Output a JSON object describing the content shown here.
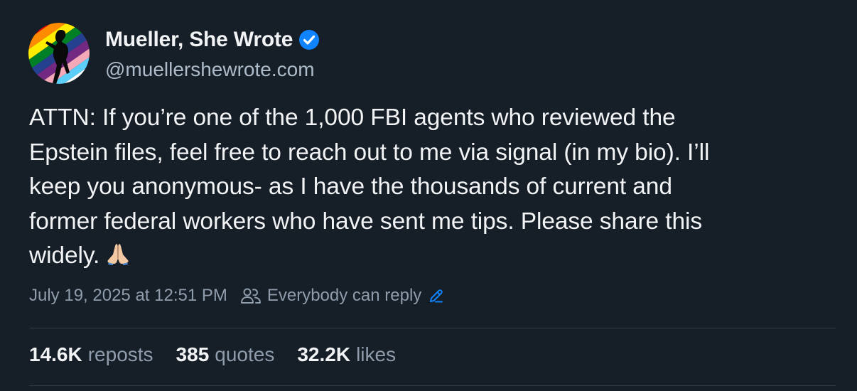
{
  "author": {
    "display_name": "Mueller, She Wrote",
    "handle": "@muellershewrote.com",
    "verified": true,
    "avatar_icon": "avatar-silhouette-rainbow",
    "verified_color": "#1083fe"
  },
  "post": {
    "text_lines": [
      "ATTN: If you’re one of the 1,000 FBI agents who reviewed the",
      "Epstein files, feel free to reach out to me via signal (in my bio). I’ll",
      "keep you anonymous- as I have the thousands of current and",
      "former federal workers who have sent me tips. Please share this",
      "widely."
    ],
    "emoji": "🙏🏻"
  },
  "meta": {
    "timestamp": "July 19, 2025 at 12:51 PM",
    "reply_setting": "Everybody can reply",
    "reply_icon": "people-icon",
    "edit_icon": "pencil-icon",
    "accent_color": "#1083fe"
  },
  "stats": {
    "reposts_count": "14.6K",
    "reposts_label": "reposts",
    "quotes_count": "385",
    "quotes_label": "quotes",
    "likes_count": "32.2K",
    "likes_label": "likes"
  }
}
